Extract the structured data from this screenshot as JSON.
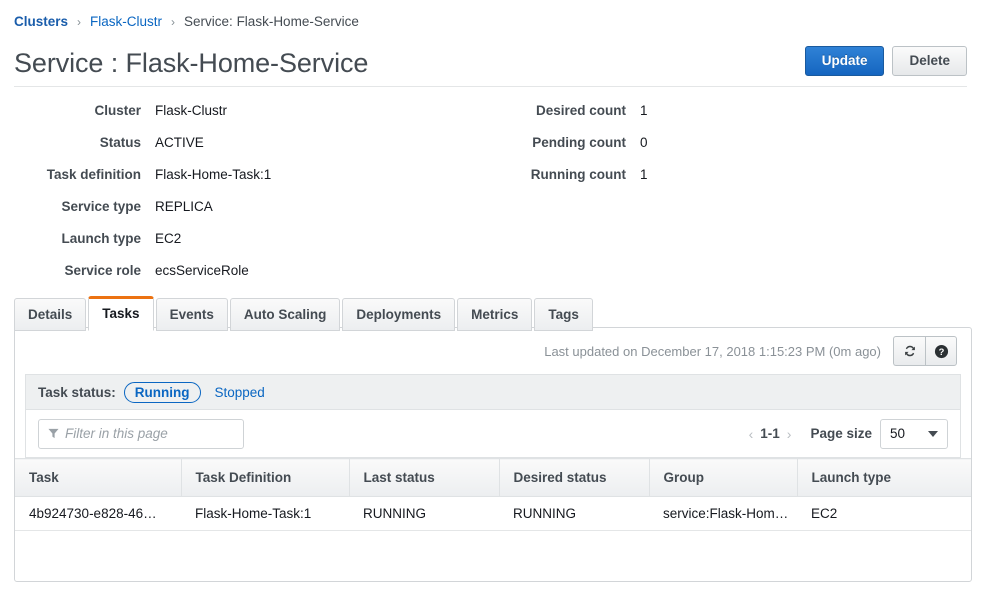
{
  "breadcrumb": {
    "items": [
      {
        "label": "Clusters",
        "type": "link-bold"
      },
      {
        "label": "Flask-Clustr",
        "type": "link"
      },
      {
        "label": "Service: Flask-Home-Service",
        "type": "current"
      }
    ],
    "separator": "›"
  },
  "header": {
    "title": "Service : Flask-Home-Service",
    "update_label": "Update",
    "delete_label": "Delete"
  },
  "details": {
    "left": [
      {
        "label": "Cluster",
        "value": "Flask-Clustr",
        "style": "link"
      },
      {
        "label": "Status",
        "value": "ACTIVE",
        "style": "green"
      },
      {
        "label": "Task definition",
        "value": "Flask-Home-Task:1",
        "style": "link"
      },
      {
        "label": "Service type",
        "value": "REPLICA",
        "style": "plain"
      },
      {
        "label": "Launch type",
        "value": "EC2",
        "style": "plain"
      },
      {
        "label": "Service role",
        "value": "ecsServiceRole",
        "style": "plain"
      }
    ],
    "right": [
      {
        "label": "Desired count",
        "value": "1",
        "style": "plain"
      },
      {
        "label": "Pending count",
        "value": "0",
        "style": "plain"
      },
      {
        "label": "Running count",
        "value": "1",
        "style": "plain"
      }
    ]
  },
  "tabs": [
    {
      "label": "Details",
      "active": false
    },
    {
      "label": "Tasks",
      "active": true
    },
    {
      "label": "Events",
      "active": false
    },
    {
      "label": "Auto Scaling",
      "active": false
    },
    {
      "label": "Deployments",
      "active": false
    },
    {
      "label": "Metrics",
      "active": false
    },
    {
      "label": "Tags",
      "active": false
    }
  ],
  "panel": {
    "last_updated": "Last updated on December 17, 2018 1:15:23 PM (0m ago)",
    "refresh_icon": "refresh-icon",
    "help_icon": "help-icon",
    "task_status": {
      "label": "Task status:",
      "options": [
        {
          "label": "Running",
          "selected": true
        },
        {
          "label": "Stopped",
          "selected": false
        }
      ]
    },
    "filter": {
      "placeholder": "Filter in this page",
      "value": "",
      "icon": "funnel-icon"
    },
    "pagination": {
      "prev": "‹",
      "range": "1-1",
      "next": "›",
      "page_size_label": "Page size",
      "page_size_value": "50"
    }
  },
  "table": {
    "columns": [
      "Task",
      "Task Definition",
      "Last status",
      "Desired status",
      "Group",
      "Launch type"
    ],
    "rows": [
      {
        "task": "4b924730-e828-46…",
        "task_definition": "Flask-Home-Task:1",
        "last_status": "RUNNING",
        "desired_status": "RUNNING",
        "group": "service:Flask-Hom…",
        "launch_type": "EC2"
      }
    ]
  },
  "colors": {
    "link": "#0a66c2",
    "accent": "#ec7211",
    "success": "#1d9c47",
    "primary_button": "#1565c0"
  }
}
